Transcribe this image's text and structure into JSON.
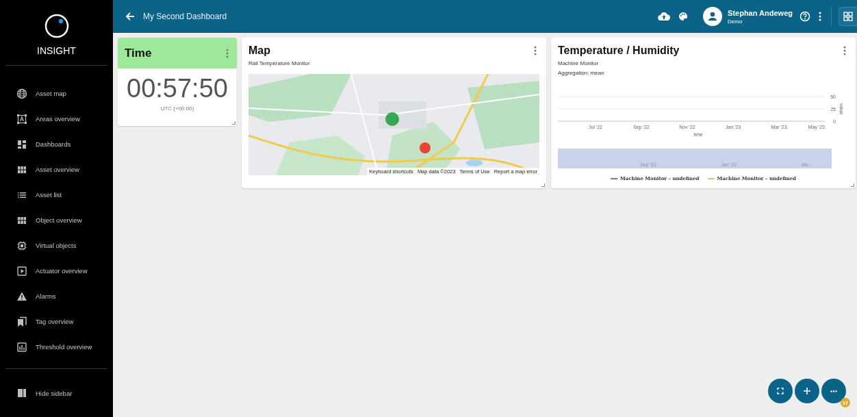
{
  "sidebar": {
    "logo_text": "INSIGHT",
    "items": [
      {
        "label": "Asset map"
      },
      {
        "label": "Areas overview"
      },
      {
        "label": "Dashboards"
      },
      {
        "label": "Asset overview"
      },
      {
        "label": "Asset list"
      },
      {
        "label": "Object overview"
      },
      {
        "label": "Virtual objects"
      },
      {
        "label": "Actuator overview"
      },
      {
        "label": "Alarms"
      },
      {
        "label": "Tag overview"
      },
      {
        "label": "Threshold overview"
      }
    ],
    "footer_item": {
      "label": "Hide sidebar"
    }
  },
  "topbar": {
    "title": "My Second Dashboard",
    "user_name": "Stephan Andeweg",
    "user_role": "Demo"
  },
  "widgets": [
    {
      "kind": "clock",
      "title": "Time",
      "time": "00:57:50",
      "timezone": "UTC (+00:00)"
    },
    {
      "kind": "map",
      "title": "Map",
      "subtitle": "Rail Temperature Monitor",
      "attribution": [
        "Keyboard shortcuts",
        "Map data ©2023",
        "Terms of Use",
        "Report a map error"
      ]
    },
    {
      "kind": "chart",
      "title": "Temperature / Humidity",
      "subtitle": "Machine Monitor",
      "aggregation": "Aggregation: mean",
      "chart_data": {
        "type": "line",
        "xlabel": "time",
        "ylabel": "value",
        "ylim": [
          0,
          50
        ],
        "yticks": [
          0,
          25,
          50
        ],
        "categories": [
          "Jul '22",
          "Sep '22",
          "Nov '22",
          "Jan '23",
          "Mar '23",
          "May '23"
        ],
        "series": [
          {
            "name": "Machine Monitor – undefined",
            "color": "#7e76b8",
            "values": [
              null,
              null,
              null,
              null,
              null,
              null
            ]
          },
          {
            "name": "Machine Monitor – undefined",
            "color": "#b8cc96",
            "values": [
              null,
              null,
              null,
              null,
              null,
              null
            ]
          }
        ]
      },
      "navigator_labels": [
        "Sep '22",
        "Jan '23",
        "Ma..."
      ]
    }
  ],
  "fab_badge": "1Y"
}
